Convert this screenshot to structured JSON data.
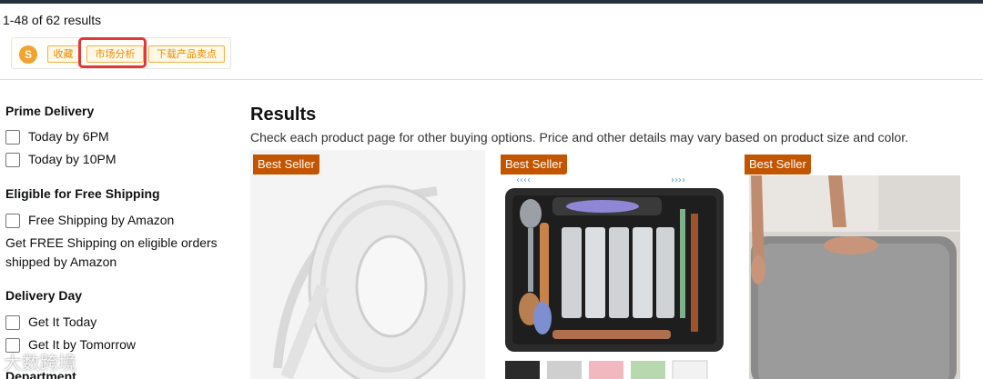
{
  "results_count": "1-48 of 62 results",
  "extension": {
    "logo_icon": "s-logo-icon",
    "favorite_label": "收藏",
    "market_analysis_label": "市场分析",
    "download_points_label": "下载产品卖点"
  },
  "filters": {
    "prime": {
      "heading": "Prime Delivery",
      "options": [
        "Today by 6PM",
        "Today by 10PM"
      ]
    },
    "free_shipping": {
      "heading": "Eligible for Free Shipping",
      "option": "Free Shipping by Amazon",
      "note": "Get FREE Shipping on eligible orders shipped by Amazon"
    },
    "delivery_day": {
      "heading": "Delivery Day",
      "options": [
        "Get It Today",
        "Get It by Tomorrow"
      ]
    },
    "department": {
      "heading": "Department"
    }
  },
  "results": {
    "title": "Results",
    "subtitle": "Check each product page for other buying options. Price and other details may vary based on product size and color."
  },
  "products": [
    {
      "badge": "Best Seller",
      "image_icon": "tape-roll-image"
    },
    {
      "badge": "Best Seller",
      "image_icon": "utensil-organizer-image"
    },
    {
      "badge": "Best Seller",
      "image_icon": "bath-mat-image"
    }
  ],
  "watermark": "大数跨境",
  "colors": {
    "badge": "#c45500",
    "highlight": "#e0383b",
    "extension_accent": "#e98c00"
  }
}
